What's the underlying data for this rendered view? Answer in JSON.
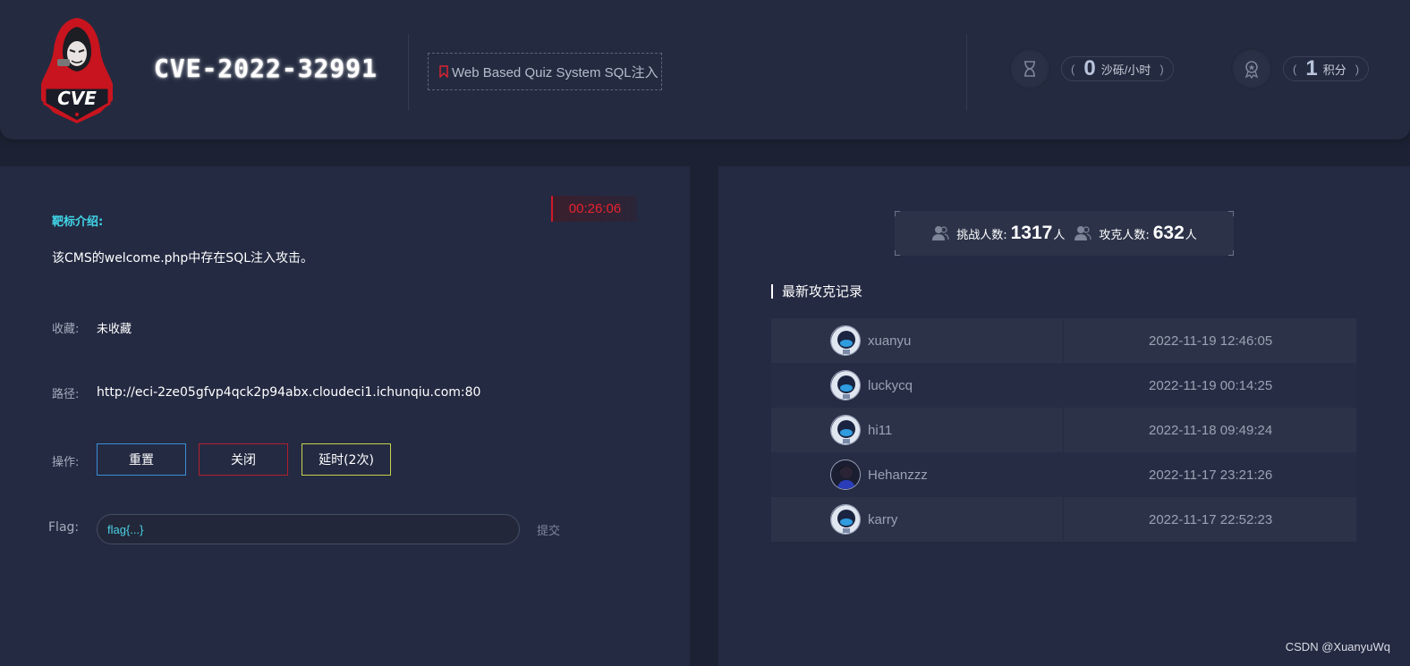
{
  "header": {
    "cve_id": "CVE-2022-32991",
    "logo_text": "CVE",
    "task_name": "Web Based Quiz System SQL注入",
    "stats": [
      {
        "icon": "hourglass-icon",
        "open": "(",
        "value": "0",
        "unit": "沙砾/小时",
        "close": ")"
      },
      {
        "icon": "medal-icon",
        "open": "(",
        "value": "1",
        "unit": "积分",
        "close": ")"
      }
    ]
  },
  "target": {
    "timer": "00:26:06",
    "intro_label": "靶标介绍:",
    "intro_text": "该CMS的welcome.php中存在SQL注入攻击。",
    "favorite_label": "收藏:",
    "favorite_value": "未收藏",
    "path_label": "路径:",
    "path_value": "http://eci-2ze05gfvp4qck2p94abx.cloudeci1.ichunqiu.com:80",
    "ops_label": "操作:",
    "buttons": {
      "reset": "重置",
      "close": "关闭",
      "delay": "延时(2次)"
    },
    "flag_label": "Flag:",
    "flag_placeholder": "flag{...}",
    "submit": "提交"
  },
  "stats_panel": {
    "challengers_label": "挑战人数:",
    "challengers_count": "1317",
    "challengers_unit": "人",
    "solvers_label": "攻克人数:",
    "solvers_count": "632",
    "solvers_unit": "人"
  },
  "records": {
    "title": "最新攻克记录",
    "rows": [
      {
        "username": "xuanyu",
        "time": "2022-11-19 12:46:05"
      },
      {
        "username": "luckycq",
        "time": "2022-11-19 00:14:25"
      },
      {
        "username": "hi11",
        "time": "2022-11-18 09:49:24"
      },
      {
        "username": "Hehanzzz",
        "time": "2022-11-17 23:21:26"
      },
      {
        "username": "karry",
        "time": "2022-11-17 22:52:23"
      }
    ]
  },
  "watermark": "CSDN @XuanyuWq"
}
